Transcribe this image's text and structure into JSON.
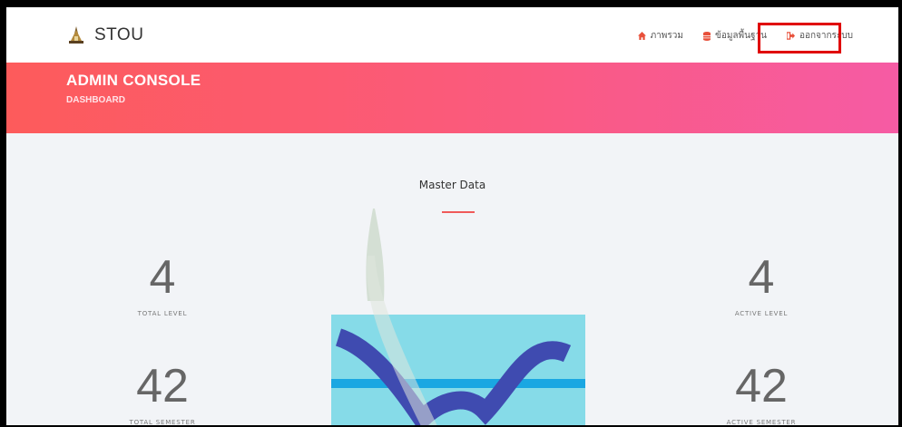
{
  "navbar": {
    "brand": "STOU",
    "items": [
      {
        "label": "ภาพรวม",
        "icon": "home-icon"
      },
      {
        "label": "ข้อมูลพื้นฐาน",
        "icon": "database-icon"
      },
      {
        "label": "ออกจากระบบ",
        "icon": "logout-icon"
      }
    ]
  },
  "banner": {
    "title": "ADMIN CONSOLE",
    "subtitle": "DASHBOARD"
  },
  "main": {
    "section_title": "Master Data",
    "stats": {
      "total_level": {
        "value": "4",
        "label": "TOTAL LEVEL"
      },
      "active_level": {
        "value": "4",
        "label": "ACTIVE LEVEL"
      },
      "total_semester": {
        "value": "42",
        "label": "TOTAL SEMESTER"
      },
      "active_semester": {
        "value": "42",
        "label": "ACTIVE SEMESTER"
      }
    }
  },
  "colors": {
    "banner_start": "#fd5b5b",
    "banner_end": "#f65ba4",
    "accent": "#f05a5a",
    "highlight": "#e00000"
  }
}
